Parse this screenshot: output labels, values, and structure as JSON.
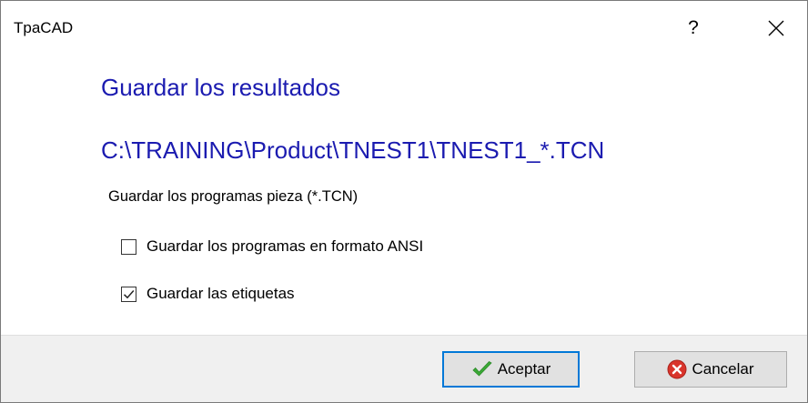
{
  "window": {
    "title": "TpaCAD",
    "help_label": "?",
    "close_label": "✕"
  },
  "content": {
    "heading": "Guardar los resultados",
    "path": "C:\\TRAINING\\Product\\TNEST1\\TNEST1_*.TCN",
    "subtitle": "Guardar los programas pieza (*.TCN)"
  },
  "options": [
    {
      "label": "Guardar los programas en formato ANSI",
      "checked": false
    },
    {
      "label": "Guardar las etiquetas",
      "checked": true
    }
  ],
  "buttons": {
    "ok_label": "Aceptar",
    "ok_icon": "checkmark-icon",
    "cancel_label": "Cancelar",
    "cancel_icon": "cancel-x-icon"
  },
  "colors": {
    "heading": "#1b1bb0",
    "ok_border": "#0078d7",
    "footer_bg": "#f0f0f0",
    "check_green": "#3aa935",
    "cancel_red": "#d9342b"
  }
}
